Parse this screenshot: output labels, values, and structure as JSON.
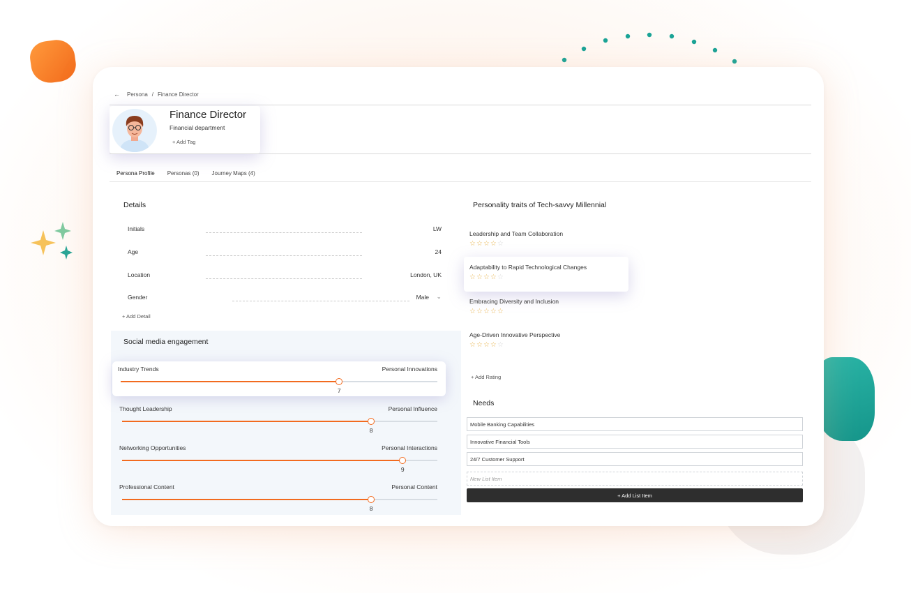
{
  "breadcrumb": {
    "root": "Persona",
    "separator": "/",
    "current": "Finance Director"
  },
  "persona": {
    "title": "Finance Director",
    "department": "Financial department",
    "add_tag": "+ Add Tag"
  },
  "tabs": [
    "Persona Profile",
    "Personas (0)",
    "Journey Maps (4)"
  ],
  "details": {
    "title": "Details",
    "rows": [
      {
        "label": "Initials",
        "value": "LW"
      },
      {
        "label": "Age",
        "value": "24"
      },
      {
        "label": "Location",
        "value": "London, UK"
      },
      {
        "label": "Gender",
        "value": "Male"
      }
    ],
    "add_detail": "+ Add Detail"
  },
  "social": {
    "title": "Social media engagement",
    "sliders": [
      {
        "left": "Industry Trends",
        "right": "Personal Innovations",
        "value": "7",
        "fraction": 0.69
      },
      {
        "left": "Thought Leadership",
        "right": "Personal Influence",
        "value": "8",
        "fraction": 0.79
      },
      {
        "left": "Networking Opportunities",
        "right": "Personal Interactions",
        "value": "9",
        "fraction": 0.89
      },
      {
        "left": "Professional Content",
        "right": "Personal Content",
        "value": "8",
        "fraction": 0.79
      }
    ]
  },
  "traits": {
    "title": "Personality traits of Tech-savvy Millennial",
    "items": [
      {
        "name": "Leadership and Team Collaboration",
        "rating": 4
      },
      {
        "name": "Adaptability to Rapid Technological Changes",
        "rating": 4
      },
      {
        "name": "Embracing Diversity and Inclusion",
        "rating": 5
      },
      {
        "name": "Age-Driven Innovative Perspective",
        "rating": 4
      }
    ],
    "add_rating": "+ Add Rating"
  },
  "needs": {
    "title": "Needs",
    "items": [
      "Mobile Banking Capabilities",
      "Innovative Financial Tools",
      "24/7 Customer Support"
    ],
    "new_placeholder": "New List Item",
    "add_button": "+ Add List Item"
  },
  "colors": {
    "accent": "#f26b1f",
    "star": "#e8b24a",
    "teal": "#1aa396",
    "dark_button": "#2e2e2e"
  }
}
